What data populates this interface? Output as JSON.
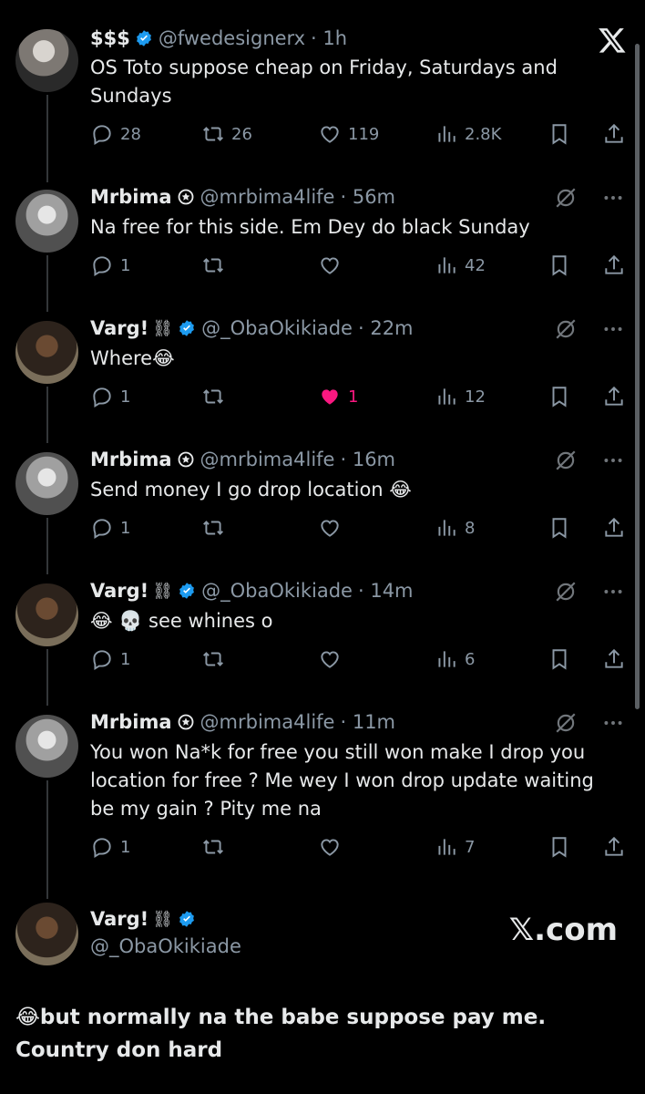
{
  "tweets": [
    {
      "name": "$$$",
      "handle": "@fwedesignerx",
      "time": "· 1h",
      "text": "OS Toto suppose cheap on Friday, Saturdays and Sundays",
      "replies": "28",
      "retweets": "26",
      "likes": "119",
      "views": "2.8K"
    },
    {
      "name": "Mrbima",
      "handle": "@mrbima4life",
      "time": "· 56m",
      "text": "Na free for this side. Em Dey do black Sunday",
      "replies": "1",
      "retweets": "",
      "likes": "",
      "views": "42"
    },
    {
      "name": "Varg!",
      "handle": "@_ObaOkikiade",
      "time": "· 22m",
      "text": "Where😂",
      "replies": "1",
      "retweets": "",
      "likes": "1",
      "views": "12"
    },
    {
      "name": "Mrbima",
      "handle": "@mrbima4life",
      "time": "· 16m",
      "text": "Send money I go drop location 😂",
      "replies": "1",
      "retweets": "",
      "likes": "",
      "views": "8"
    },
    {
      "name": "Varg!",
      "handle": "@_ObaOkikiade",
      "time": "· 14m",
      "text": "😂 💀 see whines o",
      "replies": "1",
      "retweets": "",
      "likes": "",
      "views": "6"
    },
    {
      "name": "Mrbima",
      "handle": "@mrbima4life",
      "time": "· 11m",
      "text": "You won Na*k for free you still won make I drop you location for free ? Me wey I won drop update waiting be my gain ? Pity me na",
      "replies": "1",
      "retweets": "",
      "likes": "",
      "views": "7"
    }
  ],
  "final": {
    "name": "Varg!",
    "handle": "@_ObaOkikiade",
    "text": "😂but normally na the babe suppose pay me. Country don hard",
    "site": "𝕏.com"
  },
  "colors": {
    "background": "#000000",
    "text": "#e7e9ea",
    "muted": "#8b98a5",
    "verified": "#1d9bf0",
    "like": "#f91880"
  },
  "icons": [
    "x-logo-icon",
    "reply-icon",
    "retweet-icon",
    "heart-icon",
    "views-icon",
    "bookmark-icon",
    "share-icon",
    "verified-icon",
    "grok-icon",
    "more-icon"
  ]
}
